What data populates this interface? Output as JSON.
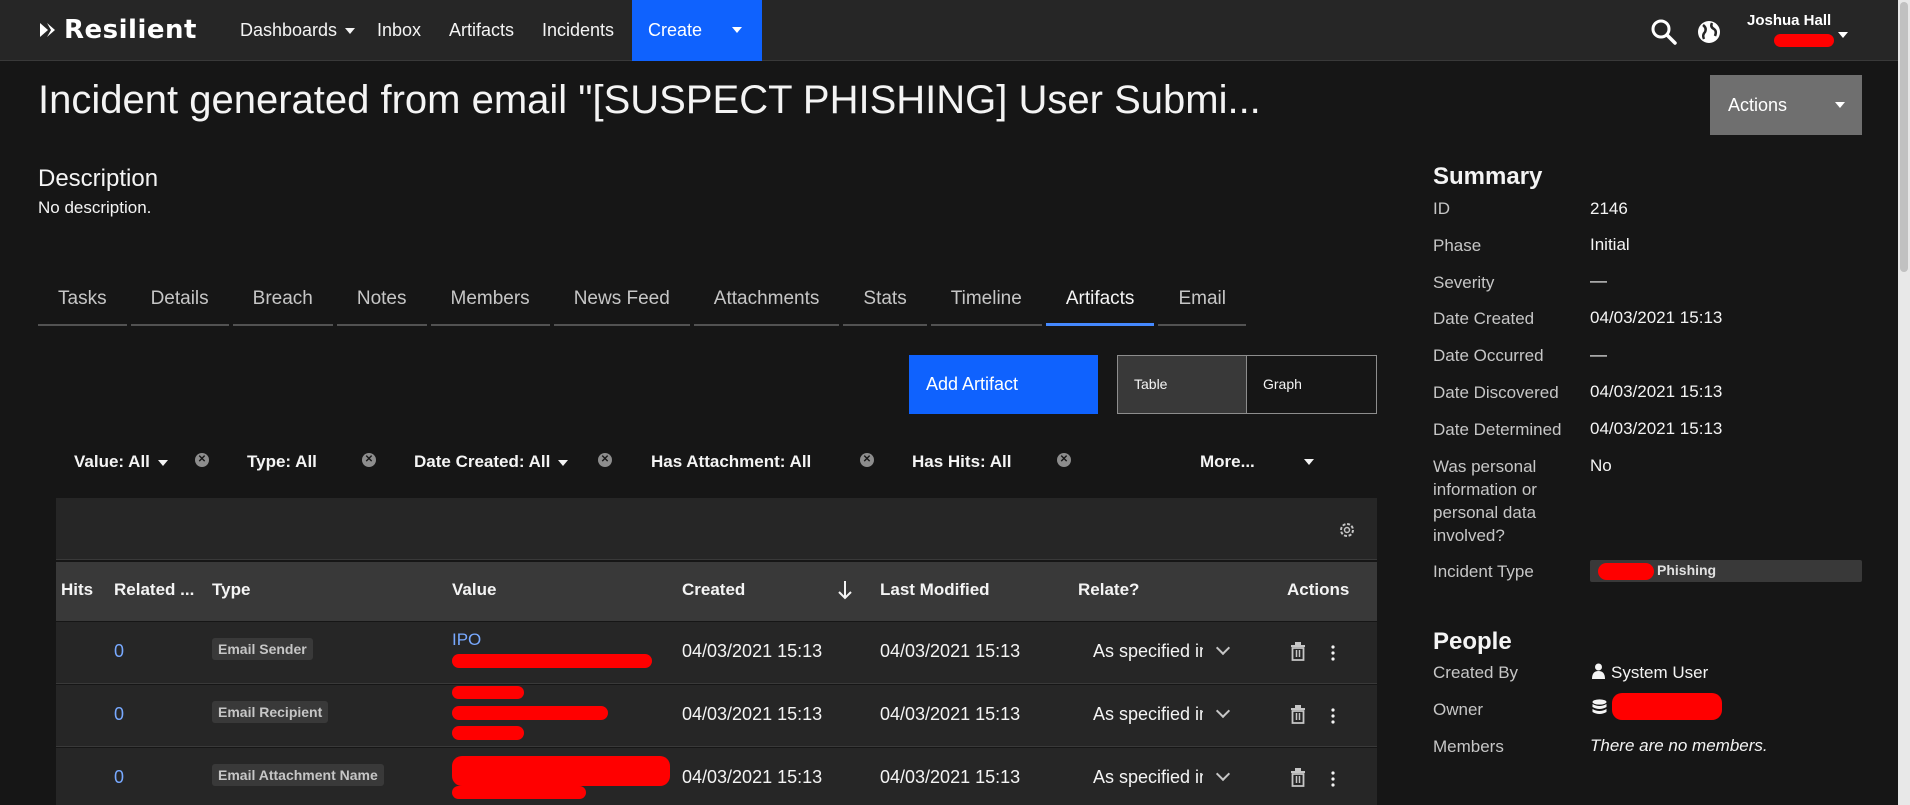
{
  "nav": {
    "logo": "Resilient",
    "items": [
      "Dashboards",
      "Inbox",
      "Artifacts",
      "Incidents"
    ],
    "create": "Create",
    "user": "Joshua Hall"
  },
  "incident": {
    "title": "Incident generated from email \"[SUSPECT PHISHING] User Submi...",
    "actions_label": "Actions",
    "description_title": "Description",
    "description_text": "No description."
  },
  "tabs": [
    "Tasks",
    "Details",
    "Breach",
    "Notes",
    "Members",
    "News Feed",
    "Attachments",
    "Stats",
    "Timeline",
    "Artifacts",
    "Email"
  ],
  "active_tab": "Artifacts",
  "artifacts": {
    "add_button": "Add Artifact",
    "view_table": "Table",
    "view_graph": "Graph",
    "filters": {
      "value": "Value: All",
      "type": "Type: All",
      "date_created": "Date Created: All",
      "has_attachment": "Has Attachment: All",
      "has_hits": "Has Hits: All",
      "more": "More..."
    },
    "columns": {
      "hits": "Hits",
      "related": "Related ...",
      "type": "Type",
      "value": "Value",
      "created": "Created",
      "last_modified": "Last Modified",
      "relate": "Relate?",
      "actions": "Actions"
    },
    "rows": [
      {
        "related": "0",
        "type": "Email Sender",
        "value": "IPO",
        "created": "04/03/2021 15:13",
        "modified": "04/03/2021 15:13",
        "relate": "As specified in"
      },
      {
        "related": "0",
        "type": "Email Recipient",
        "value": "",
        "created": "04/03/2021 15:13",
        "modified": "04/03/2021 15:13",
        "relate": "As specified in"
      },
      {
        "related": "0",
        "type": "Email Attachment Name",
        "value": "",
        "created": "04/03/2021 15:13",
        "modified": "04/03/2021 15:13",
        "relate": "As specified in"
      }
    ]
  },
  "summary": {
    "title": "Summary",
    "id_label": "ID",
    "id": "2146",
    "phase_label": "Phase",
    "phase": "Initial",
    "severity_label": "Severity",
    "severity": "—",
    "date_created_label": "Date Created",
    "date_created": "04/03/2021 15:13",
    "date_occurred_label": "Date Occurred",
    "date_occurred": "—",
    "date_discovered_label": "Date Discovered",
    "date_discovered": "04/03/2021 15:13",
    "date_determined_label": "Date Determined",
    "date_determined": "04/03/2021 15:13",
    "personal_label": "Was personal information or personal data involved?",
    "personal": "No",
    "incident_type_label": "Incident Type",
    "incident_type": "Phishing"
  },
  "people": {
    "title": "People",
    "created_by_label": "Created By",
    "created_by": "System User",
    "owner_label": "Owner",
    "members_label": "Members",
    "members": "There are no members."
  },
  "colors": {
    "accent": "#0f62fe",
    "link": "#78a9ff",
    "background": "#161616",
    "redaction": "#ff0000"
  }
}
